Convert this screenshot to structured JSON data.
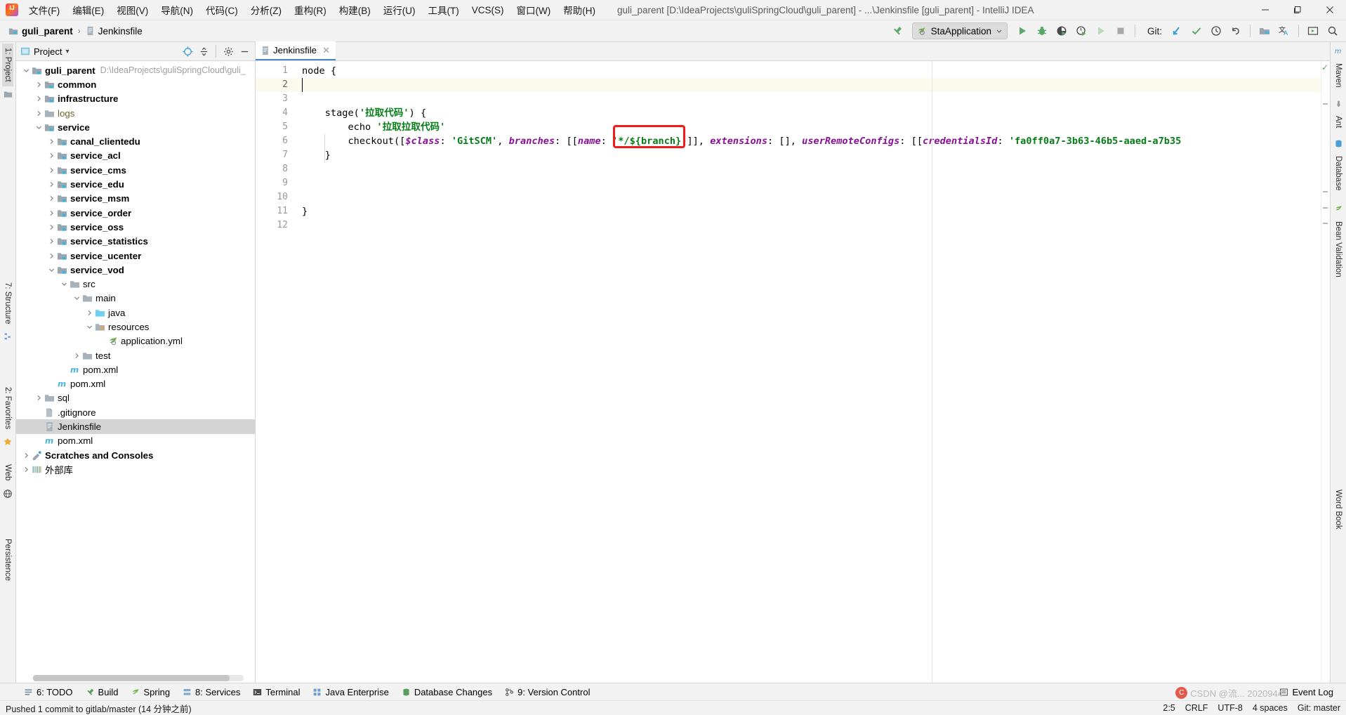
{
  "window": {
    "title": "guli_parent [D:\\IdeaProjects\\guliSpringCloud\\guli_parent] - ...\\Jenkinsfile [guli_parent] - IntelliJ IDEA",
    "minimize": "–",
    "maximize": "❐",
    "close": "✕"
  },
  "menu": [
    {
      "label": "文件(F)"
    },
    {
      "label": "编辑(E)"
    },
    {
      "label": "视图(V)"
    },
    {
      "label": "导航(N)"
    },
    {
      "label": "代码(C)"
    },
    {
      "label": "分析(Z)"
    },
    {
      "label": "重构(R)"
    },
    {
      "label": "构建(B)"
    },
    {
      "label": "运行(U)"
    },
    {
      "label": "工具(T)"
    },
    {
      "label": "VCS(S)"
    },
    {
      "label": "窗口(W)"
    },
    {
      "label": "帮助(H)"
    }
  ],
  "navbar": {
    "crumbs": [
      {
        "label": "guli_parent",
        "icon": "module-icon"
      },
      {
        "label": "Jenkinsfile",
        "icon": "file-icon"
      }
    ],
    "separator": "›",
    "run_config": "StaApplication",
    "run_config_chevron": "⌄",
    "git_label": "Git:"
  },
  "project_panel": {
    "title": "Project",
    "dropdown_caret": "▾",
    "tree": [
      {
        "label": "guli_parent",
        "sub": "D:\\IdeaProjects\\guliSpringCloud\\guli_",
        "depth": 0,
        "twisty": "open",
        "icon": "module-icon",
        "style": "bold"
      },
      {
        "label": "common",
        "depth": 1,
        "twisty": "closed",
        "icon": "module-icon",
        "style": "bold"
      },
      {
        "label": "infrastructure",
        "depth": 1,
        "twisty": "closed",
        "icon": "module-icon",
        "style": "bold"
      },
      {
        "label": "logs",
        "depth": 1,
        "twisty": "closed",
        "icon": "folder-icon",
        "style": "logs"
      },
      {
        "label": "service",
        "depth": 1,
        "twisty": "open",
        "icon": "module-icon",
        "style": "bold"
      },
      {
        "label": "canal_clientedu",
        "depth": 2,
        "twisty": "closed",
        "icon": "module-icon",
        "style": "bold"
      },
      {
        "label": "service_acl",
        "depth": 2,
        "twisty": "closed",
        "icon": "module-icon",
        "style": "bold"
      },
      {
        "label": "service_cms",
        "depth": 2,
        "twisty": "closed",
        "icon": "module-icon",
        "style": "bold"
      },
      {
        "label": "service_edu",
        "depth": 2,
        "twisty": "closed",
        "icon": "module-icon",
        "style": "bold"
      },
      {
        "label": "service_msm",
        "depth": 2,
        "twisty": "closed",
        "icon": "module-icon",
        "style": "bold"
      },
      {
        "label": "service_order",
        "depth": 2,
        "twisty": "closed",
        "icon": "module-icon",
        "style": "bold"
      },
      {
        "label": "service_oss",
        "depth": 2,
        "twisty": "closed",
        "icon": "module-icon",
        "style": "bold"
      },
      {
        "label": "service_statistics",
        "depth": 2,
        "twisty": "closed",
        "icon": "module-icon",
        "style": "bold"
      },
      {
        "label": "service_ucenter",
        "depth": 2,
        "twisty": "closed",
        "icon": "module-icon",
        "style": "bold"
      },
      {
        "label": "service_vod",
        "depth": 2,
        "twisty": "open",
        "icon": "module-icon",
        "style": "bold"
      },
      {
        "label": "src",
        "depth": 3,
        "twisty": "open",
        "icon": "folder-icon",
        "style": "plain"
      },
      {
        "label": "main",
        "depth": 4,
        "twisty": "open",
        "icon": "folder-icon",
        "style": "plain"
      },
      {
        "label": "java",
        "depth": 5,
        "twisty": "closed",
        "icon": "source-folder-icon",
        "style": "plain"
      },
      {
        "label": "resources",
        "depth": 5,
        "twisty": "open",
        "icon": "resources-folder-icon",
        "style": "plain"
      },
      {
        "label": "application.yml",
        "depth": 6,
        "twisty": "none",
        "icon": "spring-yaml-icon",
        "style": "plain"
      },
      {
        "label": "test",
        "depth": 4,
        "twisty": "closed",
        "icon": "folder-icon",
        "style": "plain"
      },
      {
        "label": "pom.xml",
        "depth": 3,
        "twisty": "none",
        "icon": "maven-icon",
        "style": "plain"
      },
      {
        "label": "pom.xml",
        "depth": 2,
        "twisty": "none",
        "icon": "maven-icon",
        "style": "plain"
      },
      {
        "label": "sql",
        "depth": 1,
        "twisty": "closed",
        "icon": "folder-icon",
        "style": "plain"
      },
      {
        "label": ".gitignore",
        "depth": 1,
        "twisty": "none",
        "icon": "gitignore-icon",
        "style": "plain"
      },
      {
        "label": "Jenkinsfile",
        "depth": 1,
        "twisty": "none",
        "icon": "file-icon",
        "style": "plain",
        "selected": true
      },
      {
        "label": "pom.xml",
        "depth": 1,
        "twisty": "none",
        "icon": "maven-icon",
        "style": "plain"
      },
      {
        "label": "Scratches and Consoles",
        "depth": 0,
        "twisty": "closed",
        "icon": "scratches-icon",
        "style": "bold"
      },
      {
        "label": "外部库",
        "depth": 0,
        "twisty": "closed",
        "icon": "library-icon",
        "style": "plain"
      }
    ]
  },
  "left_rail": [
    {
      "label": "1: Project",
      "active": true
    },
    {
      "label": "7: Structure",
      "active": false
    },
    {
      "label": "2: Favorites",
      "active": false
    },
    {
      "label": "Web",
      "active": false
    },
    {
      "label": "Persistence",
      "active": false
    }
  ],
  "right_rail": [
    {
      "label": "Maven"
    },
    {
      "label": "Ant"
    },
    {
      "label": "Database"
    },
    {
      "label": "Bean Validation"
    },
    {
      "label": "Word Book"
    }
  ],
  "editor": {
    "tab": {
      "label": "Jenkinsfile",
      "close": "✕"
    },
    "line_numbers": [
      "1",
      "2",
      "3",
      "4",
      "5",
      "6",
      "7",
      "8",
      "9",
      "10",
      "11",
      "12"
    ],
    "current_line": 2,
    "lines": [
      {
        "n": 1,
        "segments": [
          {
            "t": "node {",
            "c": "plain"
          }
        ]
      },
      {
        "n": 2,
        "segments": []
      },
      {
        "n": 3,
        "segments": []
      },
      {
        "n": 4,
        "segments": [
          {
            "t": "    stage(",
            "c": "plain"
          },
          {
            "t": "'拉取代码'",
            "c": "str"
          },
          {
            "t": ") {",
            "c": "plain"
          }
        ]
      },
      {
        "n": 5,
        "segments": [
          {
            "t": "        echo ",
            "c": "plain"
          },
          {
            "t": "'拉取拉取代码'",
            "c": "str"
          }
        ]
      },
      {
        "n": 6,
        "segments": [
          {
            "t": "        checkout([",
            "c": "plain"
          },
          {
            "t": "$class",
            "c": "id"
          },
          {
            "t": ": ",
            "c": "plain"
          },
          {
            "t": "'GitSCM'",
            "c": "str"
          },
          {
            "t": ", ",
            "c": "plain"
          },
          {
            "t": "branches",
            "c": "id"
          },
          {
            "t": ": [[",
            "c": "plain"
          },
          {
            "t": "name",
            "c": "id"
          },
          {
            "t": ": ",
            "c": "plain"
          },
          {
            "t": "'*/${branch}'",
            "c": "str"
          },
          {
            "t": "]], ",
            "c": "plain"
          },
          {
            "t": "extensions",
            "c": "id"
          },
          {
            "t": ": [], ",
            "c": "plain"
          },
          {
            "t": "userRemoteConfigs",
            "c": "id"
          },
          {
            "t": ": [[",
            "c": "plain"
          },
          {
            "t": "credentialsId",
            "c": "id"
          },
          {
            "t": ": ",
            "c": "plain"
          },
          {
            "t": "'fa0ff0a7-3b63-46b5-aaed-a7b35",
            "c": "str"
          }
        ]
      },
      {
        "n": 7,
        "segments": [
          {
            "t": "    }",
            "c": "plain"
          }
        ]
      },
      {
        "n": 8,
        "segments": []
      },
      {
        "n": 9,
        "segments": []
      },
      {
        "n": 10,
        "segments": []
      },
      {
        "n": 11,
        "segments": [
          {
            "t": "}",
            "c": "plain"
          }
        ]
      },
      {
        "n": 12,
        "segments": []
      }
    ],
    "annotation_color": "#f21b1b"
  },
  "bottom_bar": [
    {
      "label": "6: TODO",
      "icon": "todo-icon"
    },
    {
      "label": "Build",
      "icon": "build-icon"
    },
    {
      "label": "Spring",
      "icon": "spring-icon"
    },
    {
      "label": "8: Services",
      "icon": "services-icon"
    },
    {
      "label": "Terminal",
      "icon": "terminal-icon"
    },
    {
      "label": "Java Enterprise",
      "icon": "java-enterprise-icon"
    },
    {
      "label": "Database Changes",
      "icon": "database-changes-icon"
    },
    {
      "label": "9: Version Control",
      "icon": "version-control-icon"
    },
    {
      "label": "Event Log",
      "icon": "event-log-icon"
    }
  ],
  "status_bar": {
    "message": "Pushed 1 commit to gitlab/master (14 分钟之前)",
    "caret": "2:5",
    "line_separator": "CRLF",
    "encoding": "UTF-8",
    "indent": "4 spaces",
    "branch": "Git: master"
  },
  "watermark": {
    "text": "CSDN @流... 2020944"
  },
  "colors": {
    "accent": "#4a86c8",
    "string": "#067d17",
    "identifier": "#871094",
    "annotation": "#f21b1b",
    "selection": "#d4d4d4",
    "current_line": "#fcfaed"
  }
}
